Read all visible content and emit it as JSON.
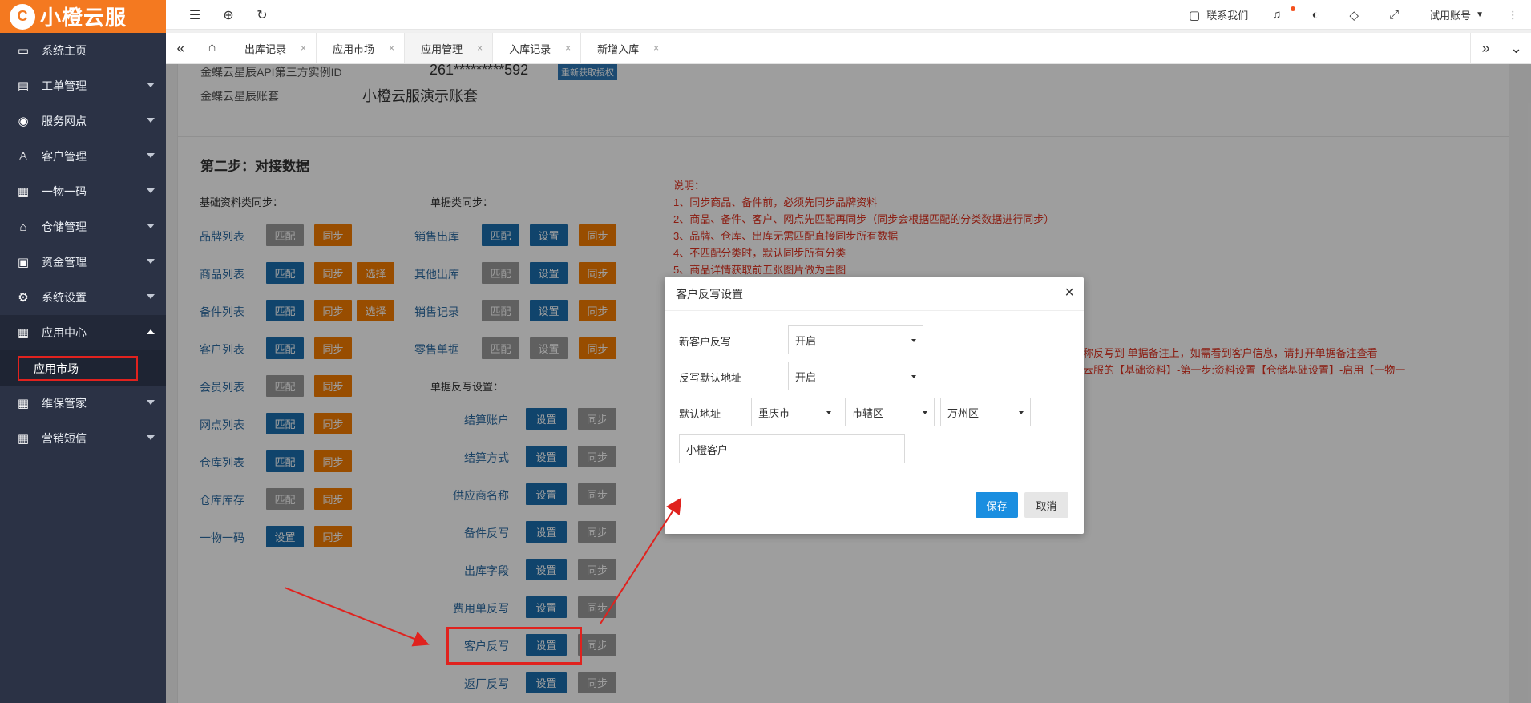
{
  "app": {
    "logo_text": "小橙云服",
    "logo_mark": "C"
  },
  "sidebar": {
    "items": [
      {
        "label": "系统主页",
        "icon": "monitor-icon",
        "glyph": "▭",
        "caret": "none"
      },
      {
        "label": "工单管理",
        "icon": "document-icon",
        "glyph": "▤",
        "caret": "down"
      },
      {
        "label": "服务网点",
        "icon": "globe-icon",
        "glyph": "◉",
        "caret": "down"
      },
      {
        "label": "客户管理",
        "icon": "user-icon",
        "glyph": "♙",
        "caret": "down"
      },
      {
        "label": "一物一码",
        "icon": "grid-icon",
        "glyph": "▦",
        "caret": "down"
      },
      {
        "label": "仓储管理",
        "icon": "bank-icon",
        "glyph": "⌂",
        "caret": "down"
      },
      {
        "label": "资金管理",
        "icon": "money-icon",
        "glyph": "▣",
        "caret": "down"
      },
      {
        "label": "系统设置",
        "icon": "gear-icon",
        "glyph": "⚙",
        "caret": "down"
      },
      {
        "label": "应用中心",
        "icon": "grid-icon",
        "glyph": "▦",
        "caret": "up"
      },
      {
        "label": "维保管家",
        "icon": "grid-icon",
        "glyph": "▦",
        "caret": "down"
      },
      {
        "label": "营销短信",
        "icon": "grid-icon",
        "glyph": "▦",
        "caret": "down"
      }
    ],
    "submenu_label": "应用市场"
  },
  "topbar": {
    "contact": "联系我们",
    "account": "试用账号"
  },
  "tabs": {
    "items": [
      {
        "label": "出库记录",
        "active": false
      },
      {
        "label": "应用市场",
        "active": false
      },
      {
        "label": "应用管理",
        "active": true
      },
      {
        "label": "入库记录",
        "active": false
      },
      {
        "label": "新增入库",
        "active": false
      }
    ]
  },
  "panel1": {
    "api_label": "金蝶云星辰API第三方实例ID",
    "api_value": "261*********592",
    "reauth_label": "重新获取授权",
    "book_label": "金蝶云星辰账套",
    "book_value": "小橙云服演示账套"
  },
  "step2": {
    "title": "第二步：对接数据",
    "basic_label": "基础资料类同步：",
    "doc_label": "单据类同步：",
    "writeback_label": "单据反写设置：",
    "basic_rows": [
      {
        "label": "品牌列表",
        "b1": "匹配",
        "b1c": "gray",
        "b2": "同步",
        "b3": ""
      },
      {
        "label": "商品列表",
        "b1": "匹配",
        "b1c": "blue",
        "b2": "同步",
        "b3": "选择"
      },
      {
        "label": "备件列表",
        "b1": "匹配",
        "b1c": "blue",
        "b2": "同步",
        "b3": "选择"
      },
      {
        "label": "客户列表",
        "b1": "匹配",
        "b1c": "blue",
        "b2": "同步",
        "b3": ""
      },
      {
        "label": "会员列表",
        "b1": "匹配",
        "b1c": "gray",
        "b2": "同步",
        "b3": ""
      },
      {
        "label": "网点列表",
        "b1": "匹配",
        "b1c": "blue",
        "b2": "同步",
        "b3": ""
      },
      {
        "label": "仓库列表",
        "b1": "匹配",
        "b1c": "blue",
        "b2": "同步",
        "b3": ""
      },
      {
        "label": "仓库库存",
        "b1": "匹配",
        "b1c": "gray",
        "b2": "同步",
        "b3": ""
      },
      {
        "label": "一物一码",
        "b1": "设置",
        "b1c": "blue",
        "b2": "同步",
        "b3": ""
      }
    ],
    "doc_rows": [
      {
        "label": "销售出库",
        "b1": "匹配",
        "b1c": "blue",
        "b2": "设置",
        "b2c": "blue",
        "b3": "同步"
      },
      {
        "label": "其他出库",
        "b1": "匹配",
        "b1c": "gray",
        "b2": "设置",
        "b2c": "blue",
        "b3": "同步"
      },
      {
        "label": "销售记录",
        "b1": "匹配",
        "b1c": "gray",
        "b2": "设置",
        "b2c": "blue",
        "b3": "同步"
      },
      {
        "label": "零售单据",
        "b1": "匹配",
        "b1c": "gray",
        "b2": "设置",
        "b2c": "gray",
        "b3": "同步"
      }
    ],
    "writeback_rows": [
      {
        "label": "结算账户",
        "b1": "设置",
        "b2": "同步"
      },
      {
        "label": "结算方式",
        "b1": "设置",
        "b2": "同步"
      },
      {
        "label": "供应商名称",
        "b1": "设置",
        "b2": "同步"
      },
      {
        "label": "备件反写",
        "b1": "设置",
        "b2": "同步"
      },
      {
        "label": "出库字段",
        "b1": "设置",
        "b2": "同步"
      },
      {
        "label": "费用单反写",
        "b1": "设置",
        "b2": "同步"
      },
      {
        "label": "客户反写",
        "b1": "设置",
        "b2": "同步"
      },
      {
        "label": "返厂反写",
        "b1": "设置",
        "b2": "同步"
      }
    ]
  },
  "notes": {
    "lines": [
      "说明：",
      "1、同步商品、备件前，必须先同步品牌资料",
      "2、商品、备件、客户、网点先匹配再同步（同步会根据匹配的分类数据进行同步）",
      "3、品牌、仓库、出库无需匹配直接同步所有数据",
      "4、不匹配分类时，默认同步所有分类",
      "5、商品详情获取前五张图片做为主图"
    ],
    "partial1": "称反写到 单据备注上，如需看到客户信息，请打开单据备注查看",
    "partial2": "云服的【基础资料】-第一步:资料设置【仓储基础设置】-启用【一物一"
  },
  "modal": {
    "title": "客户反写设置",
    "close": "×",
    "field1_label": "新客户反写",
    "field1_value": "开启",
    "field2_label": "反写默认地址",
    "field2_value": "开启",
    "field3_label": "默认地址",
    "city": "重庆市",
    "district": "市辖区",
    "county": "万州区",
    "address_value": "小橙客户",
    "save": "保存",
    "cancel": "取消"
  },
  "colors": {
    "sidebar_bg": "#2b3245",
    "logo_bg": "#f47920",
    "blue_button": "#1a6faf",
    "gray_button": "#9b9b9b",
    "orange_button": "#f57c00",
    "note_red": "#e0301e",
    "annotation_red": "#e0221e"
  }
}
